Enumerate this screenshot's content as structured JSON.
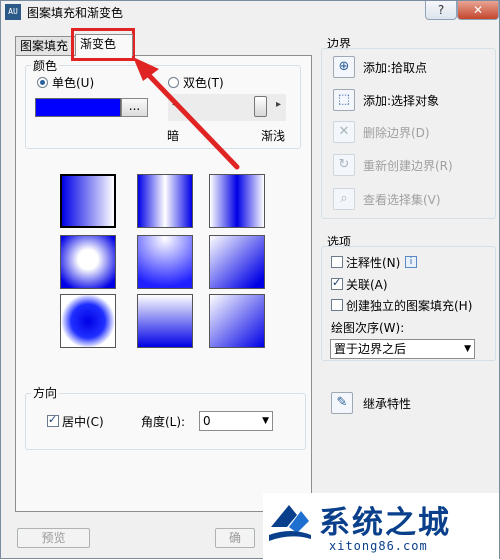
{
  "window": {
    "title": "图案填充和渐变色",
    "app_icon_text": "AU",
    "help_label": "?",
    "close_label": "✕"
  },
  "tabs": [
    {
      "label": "图案填充"
    },
    {
      "label": "渐变色",
      "active": true
    }
  ],
  "color_group": {
    "title": "颜色",
    "single_color": "单色(U)",
    "two_color": "双色(T)",
    "selected": "single",
    "swatch_color": "#0000ff",
    "browse_label": "...",
    "shade_label": "暗",
    "tint_label": "渐浅"
  },
  "gradient_patterns": {
    "count": 9,
    "selected_index": 0
  },
  "orientation": {
    "title": "方向",
    "centered_label": "居中(C)",
    "centered_checked": true,
    "angle_label": "角度(L):",
    "angle_value": "0"
  },
  "boundary": {
    "title": "边界",
    "add_pick_points": "添加:拾取点",
    "add_select_objects": "添加:选择对象",
    "remove_boundaries": "删除边界(D)",
    "recreate_boundary": "重新创建边界(R)",
    "view_selections": "查看选择集(V)"
  },
  "options": {
    "title": "选项",
    "annotative_label": "注释性(N)",
    "annotative_checked": false,
    "associative_label": "关联(A)",
    "associative_checked": true,
    "separate_label": "创建独立的图案填充(H)",
    "separate_checked": false,
    "draw_order_label": "绘图次序(W):",
    "draw_order_value": "置于边界之后"
  },
  "inherit": {
    "label": "继承特性"
  },
  "buttons": {
    "preview_label": "预览",
    "partial_label": "确"
  },
  "watermark": {
    "title": "系统之城",
    "url": "xitong86.com"
  },
  "colors": {
    "accent": "#0000ff",
    "highlight": "#e02424",
    "watermark": "#0a3f8c"
  }
}
